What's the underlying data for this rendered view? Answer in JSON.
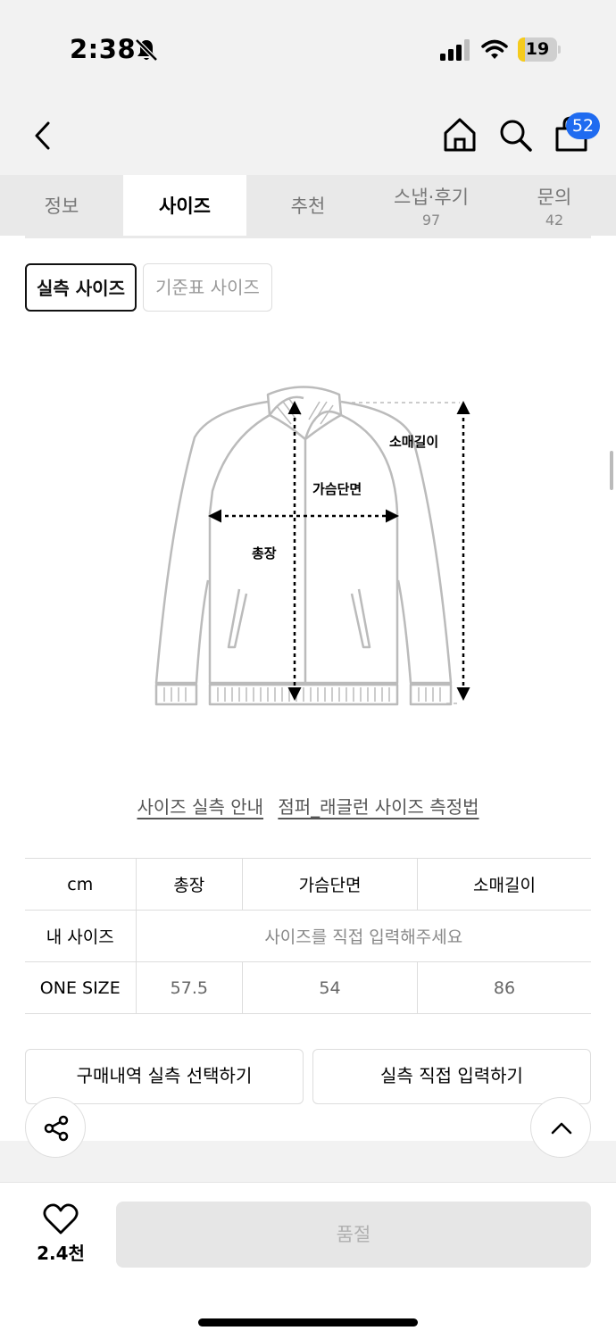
{
  "status_bar": {
    "time": "2:38",
    "battery_level": "19",
    "battery_fraction": 0.19
  },
  "nav": {
    "cart_count": "52"
  },
  "tabs": [
    {
      "label": "정보",
      "count": ""
    },
    {
      "label": "사이즈",
      "count": ""
    },
    {
      "label": "추천",
      "count": ""
    },
    {
      "label": "스냅·후기",
      "count": "97"
    },
    {
      "label": "문의",
      "count": "42"
    }
  ],
  "size_toggle": {
    "actual": "실측 사이즈",
    "standard": "기준표 사이즈"
  },
  "diagram": {
    "sleeve_label": "소매길이",
    "chest_label": "가슴단면",
    "length_label": "총장"
  },
  "guide_links": {
    "size_guide": "사이즈 실측 안내",
    "measure_method": "점퍼_래글런 사이즈 측정법"
  },
  "size_table": {
    "headers": [
      "cm",
      "총장",
      "가슴단면",
      "소매길이"
    ],
    "my_size_label": "내 사이즈",
    "my_size_placeholder": "사이즈를 직접 입력해주세요",
    "rows": [
      {
        "size": "ONE SIZE",
        "length": "57.5",
        "chest": "54",
        "sleeve": "86"
      }
    ]
  },
  "actions": {
    "select_from_history": "구매내역 실측 선택하기",
    "input_directly": "실측 직접 입력하기"
  },
  "bottom": {
    "like_count": "2.4천",
    "buy_label": "품절"
  },
  "colors": {
    "badge": "#1f6bf0",
    "battery": "#f5cb1d",
    "disabled_button": "#e6e6e6"
  },
  "icons": [
    "bell-slash-icon",
    "signal-icon",
    "wifi-icon",
    "back-chevron-icon",
    "home-icon",
    "search-icon",
    "shopping-bag-icon",
    "share-icon",
    "chevron-up-icon",
    "heart-icon"
  ]
}
